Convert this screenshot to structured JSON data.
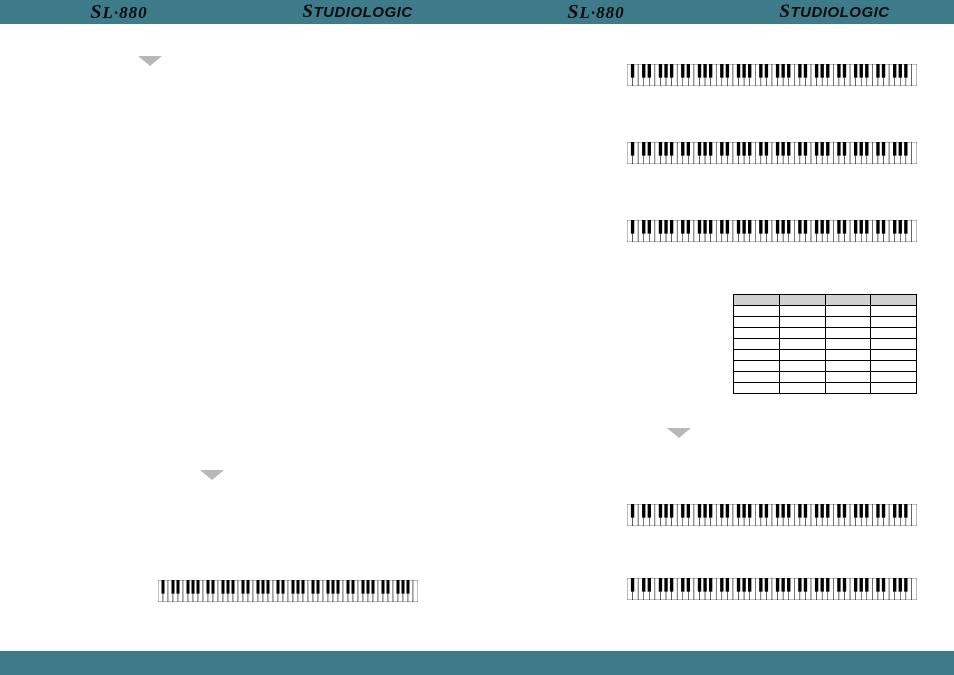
{
  "header": {
    "model": "L·880",
    "brand": "TUDIOLOGIC"
  },
  "left_page": {
    "keyboards": [
      "kb1"
    ]
  },
  "right_page": {
    "keyboards": [
      "kbA",
      "kbB",
      "kbC",
      "kbD",
      "kbE"
    ],
    "table": {
      "cols": 4,
      "rows": 8
    }
  }
}
